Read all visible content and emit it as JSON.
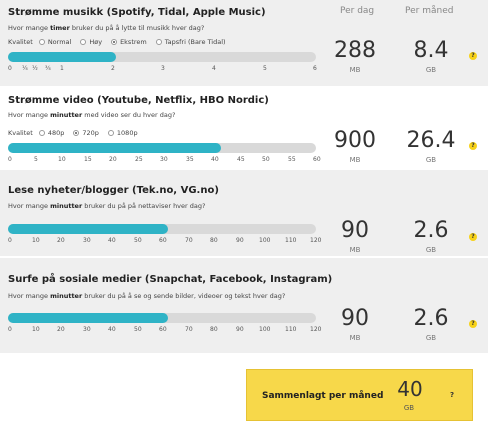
{
  "columns": {
    "per_day": "Per dag",
    "per_month": "Per måned"
  },
  "sections": [
    {
      "title": "Strømme musikk (Spotify, Tidal, Apple Music)",
      "question_pre": "Hvor mange ",
      "question_bold": "timer",
      "question_post": " bruker du på å lytte til musikk hver dag?",
      "quality_label": "Kvalitet",
      "options": [
        "Normal",
        "Høy",
        "Ekstrem",
        "Tapsfri (Bare Tidal)"
      ],
      "selected_option": "Ekstrem",
      "slider_value": 2,
      "slider_max": 6,
      "ticks": [
        "0",
        "¼",
        "½",
        "¾",
        "1",
        "2",
        "3",
        "4",
        "5",
        "6"
      ],
      "per_day": "288",
      "per_day_unit": "MB",
      "per_month": "8.4",
      "per_month_unit": "GB",
      "help": "?"
    },
    {
      "title": "Strømme video (Youtube, Netflix, HBO Nordic)",
      "question_pre": "Hvor mange ",
      "question_bold": "minutter",
      "question_post": " med video ser du hver dag?",
      "quality_label": "Kvalitet",
      "options": [
        "480p",
        "720p",
        "1080p"
      ],
      "selected_option": "720p",
      "slider_value": 40,
      "slider_max": 60,
      "ticks": [
        "0",
        "5",
        "10",
        "15",
        "20",
        "25",
        "30",
        "35",
        "40",
        "45",
        "50",
        "55",
        "60"
      ],
      "per_day": "900",
      "per_day_unit": "MB",
      "per_month": "26.4",
      "per_month_unit": "GB",
      "help": "?"
    },
    {
      "title": "Lese nyheter/blogger (Tek.no, VG.no)",
      "question_pre": "Hvor mange ",
      "question_bold": "minutter",
      "question_post": " bruker du på på nettaviser hver dag?",
      "slider_value": 60,
      "slider_max": 120,
      "ticks": [
        "0",
        "10",
        "20",
        "30",
        "40",
        "50",
        "60",
        "70",
        "80",
        "90",
        "100",
        "110",
        "120"
      ],
      "per_day": "90",
      "per_day_unit": "MB",
      "per_month": "2.6",
      "per_month_unit": "GB",
      "help": "?"
    },
    {
      "title": "Surfe på sosiale medier (Snapchat, Facebook, Instagram)",
      "question_pre": "Hvor mange ",
      "question_bold": "minutter",
      "question_post": " bruker du på å se og sende bilder, videoer og tekst hver dag?",
      "slider_value": 60,
      "slider_max": 120,
      "ticks": [
        "0",
        "10",
        "20",
        "30",
        "40",
        "50",
        "60",
        "70",
        "80",
        "90",
        "100",
        "110",
        "120"
      ],
      "per_day": "90",
      "per_day_unit": "MB",
      "per_month": "2.6",
      "per_month_unit": "GB",
      "help": "?"
    }
  ],
  "summary": {
    "label": "Sammenlagt per måned",
    "value": "40",
    "unit": "GB",
    "help": "?"
  },
  "colors": {
    "slider_fill": "#2fb3c6",
    "summary_bg": "#f7d84a",
    "help_badge": "#f7d219"
  }
}
